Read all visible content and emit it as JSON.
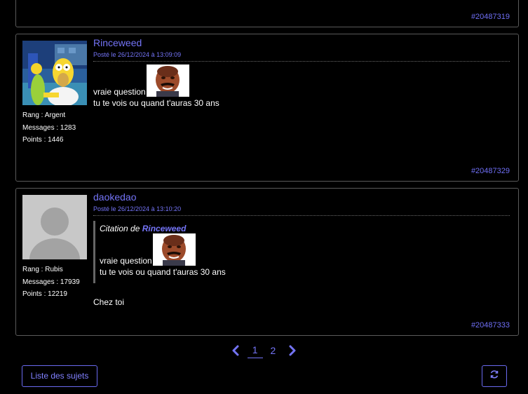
{
  "posts": [
    {
      "id": "#20487319"
    },
    {
      "author": "Rinceweed",
      "date": "Posté le 26/12/2024 à 13:09:09",
      "rank": "Rang : Argent",
      "messages": "Messages : 1283",
      "points": "Points : 1446",
      "line1": "vraie question",
      "line2": "tu te vois ou quand t'auras 30 ans",
      "id": "#20487329"
    },
    {
      "author": "daokedao",
      "date": "Posté le 26/12/2024 à 13:10:20",
      "rank": "Rang : Rubis",
      "messages": "Messages : 17939",
      "points": "Points : 12219",
      "quote_prefix": "Citation de",
      "quote_author": "Rinceweed",
      "quote_line1": "vraie question",
      "quote_line2": "tu te vois ou quand t'auras 30 ans",
      "reply": "Chez toi",
      "id": "#20487333"
    }
  ],
  "pagination": {
    "pages": [
      "1",
      "2"
    ],
    "current": "1"
  },
  "buttons": {
    "topic_list": "Liste des sujets"
  },
  "colors": {
    "accent": "#7474f7",
    "background": "#000000",
    "border": "#5a5a5a"
  },
  "icons": {
    "prev": "chevron-left-icon",
    "next": "chevron-right-icon",
    "refresh": "refresh-icon"
  }
}
